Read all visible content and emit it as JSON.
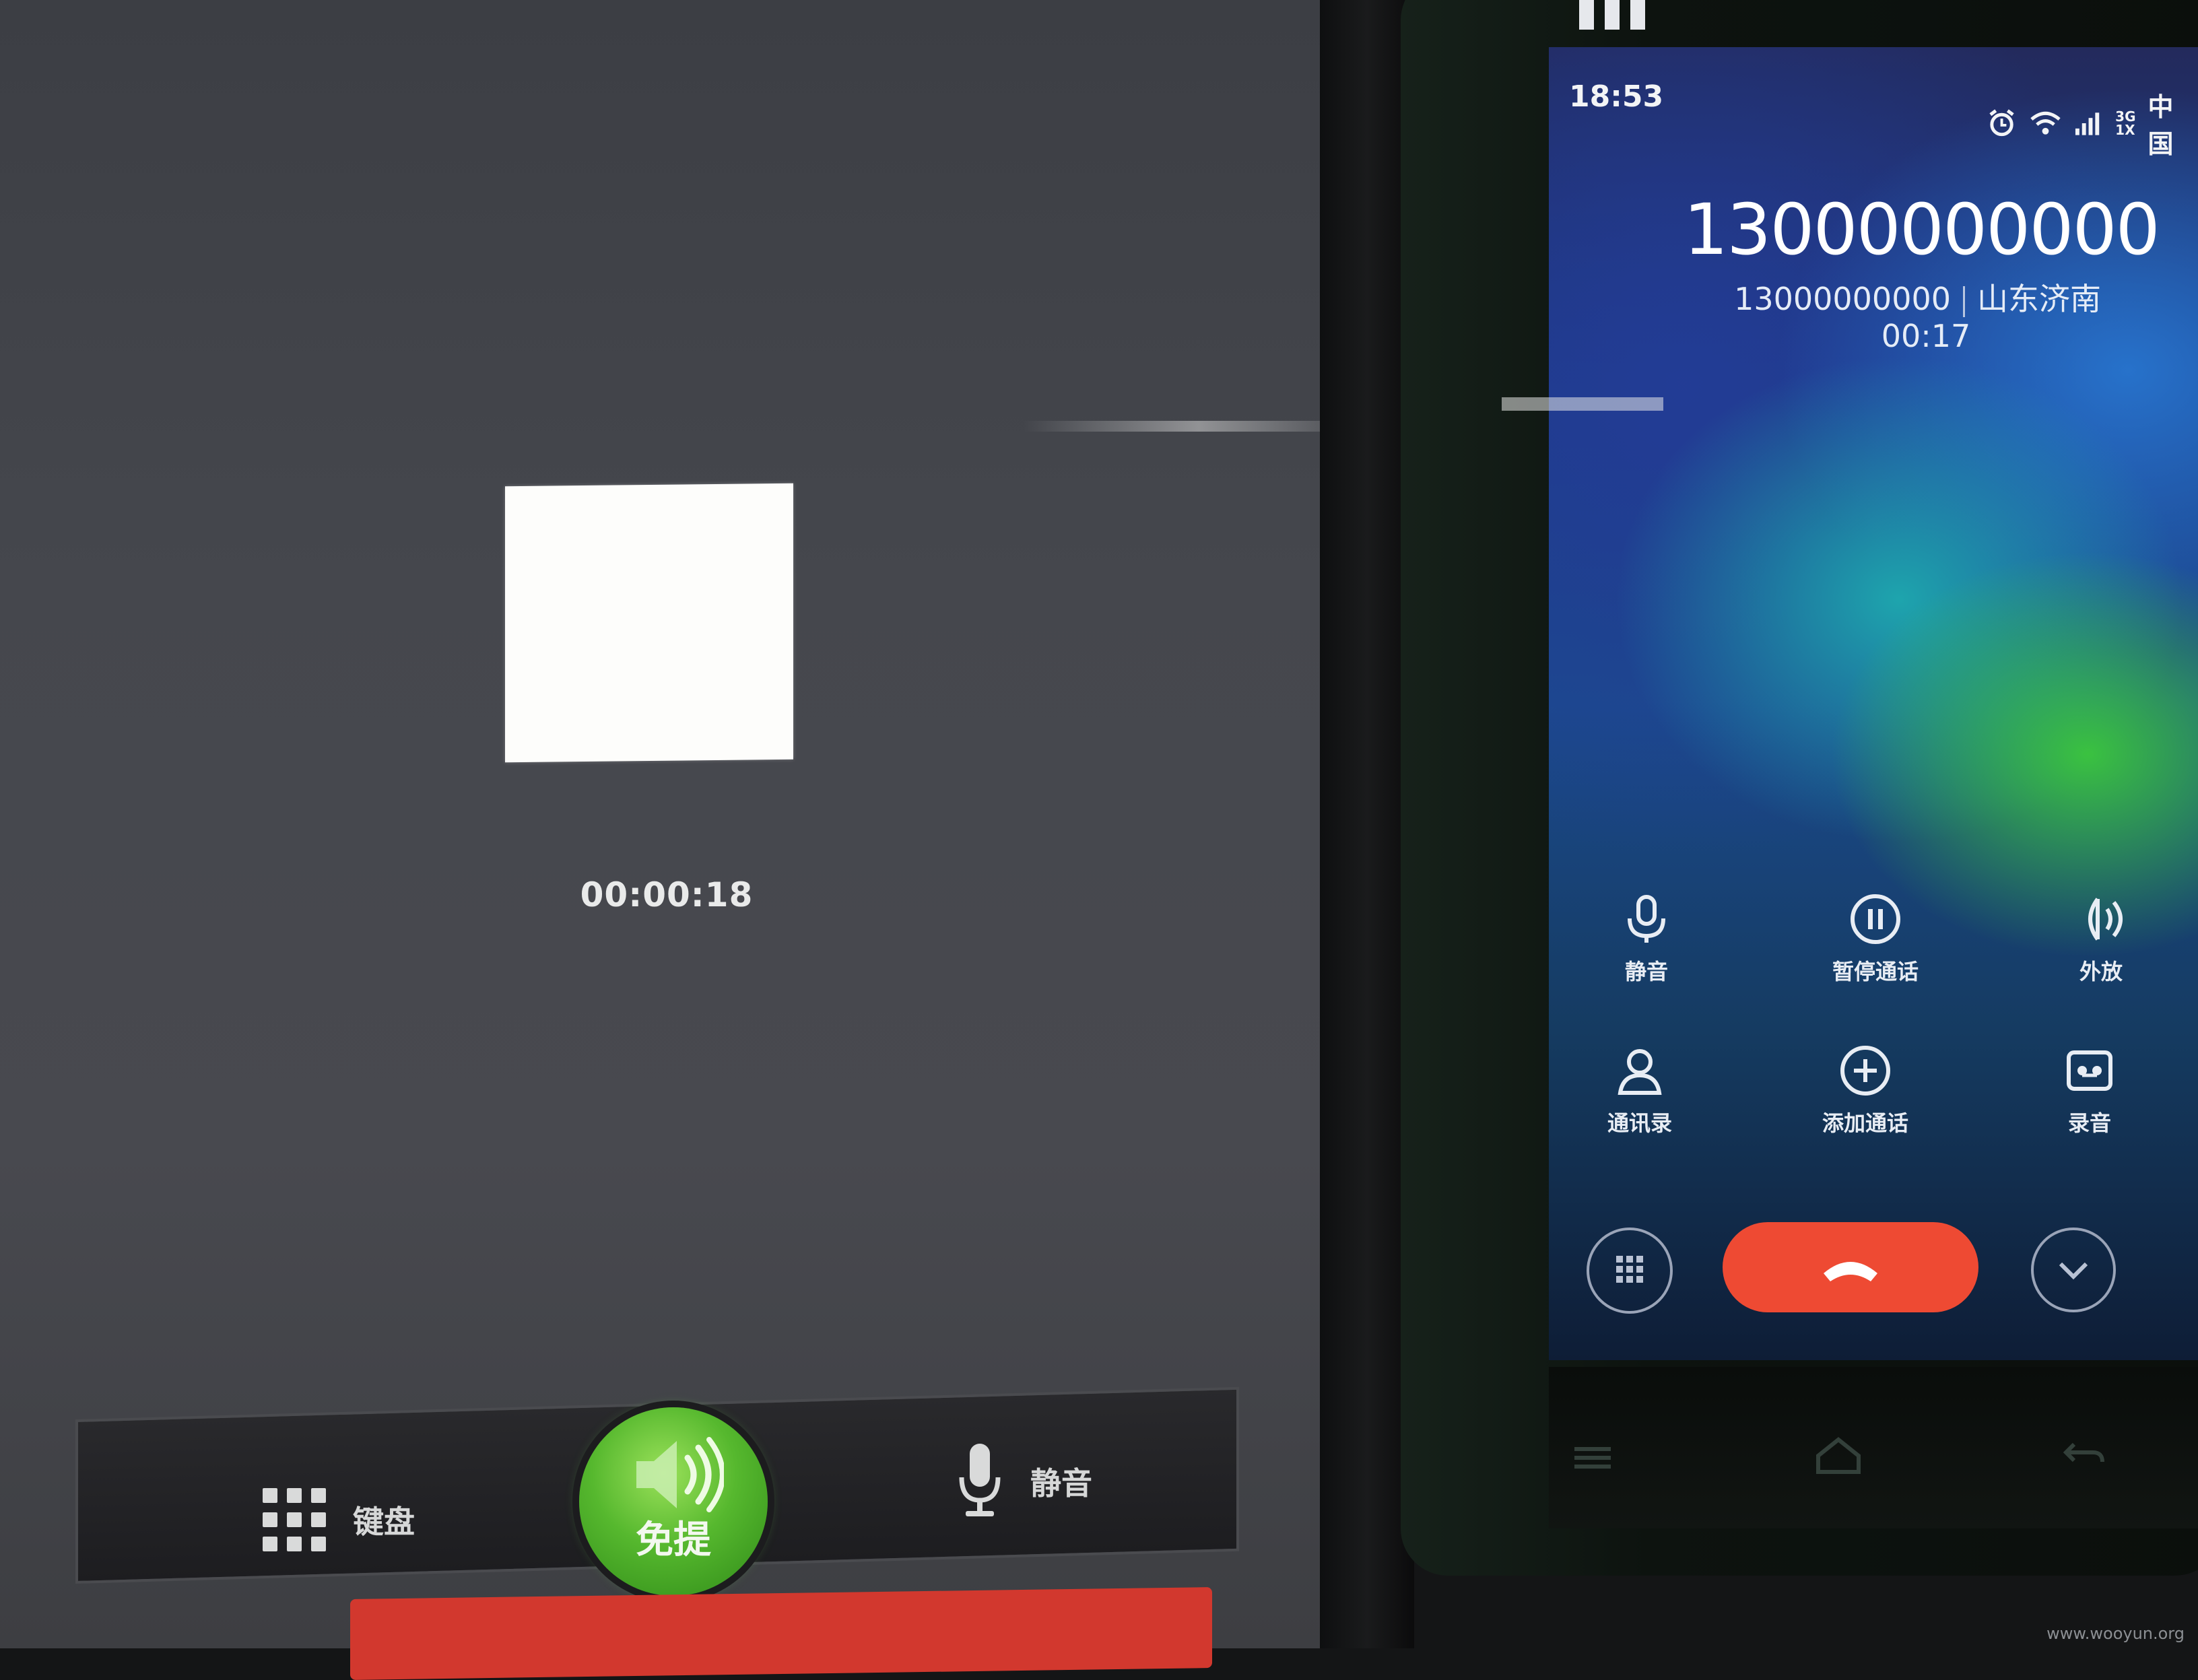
{
  "tablet": {
    "timer": "00:00:18",
    "toolbar": {
      "keypad_label": "键盘",
      "speaker_label": "免提",
      "mute_label": "静音"
    }
  },
  "phone": {
    "status": {
      "time": "18:53",
      "network": "3G",
      "network_sub": "1X",
      "carrier": "中国"
    },
    "call": {
      "title_number": "13000000000",
      "number": "13000000000",
      "location": "山东济南",
      "duration": "00:17"
    },
    "controls": {
      "mute": "静音",
      "hold": "暂停通话",
      "speaker": "外放",
      "contacts": "通讯录",
      "add_call": "添加通话",
      "record": "录音"
    }
  },
  "watermark": "www.wooyun.org",
  "colors": {
    "end_call_red": "#ee4a33",
    "speaker_green": "#56b82e"
  }
}
